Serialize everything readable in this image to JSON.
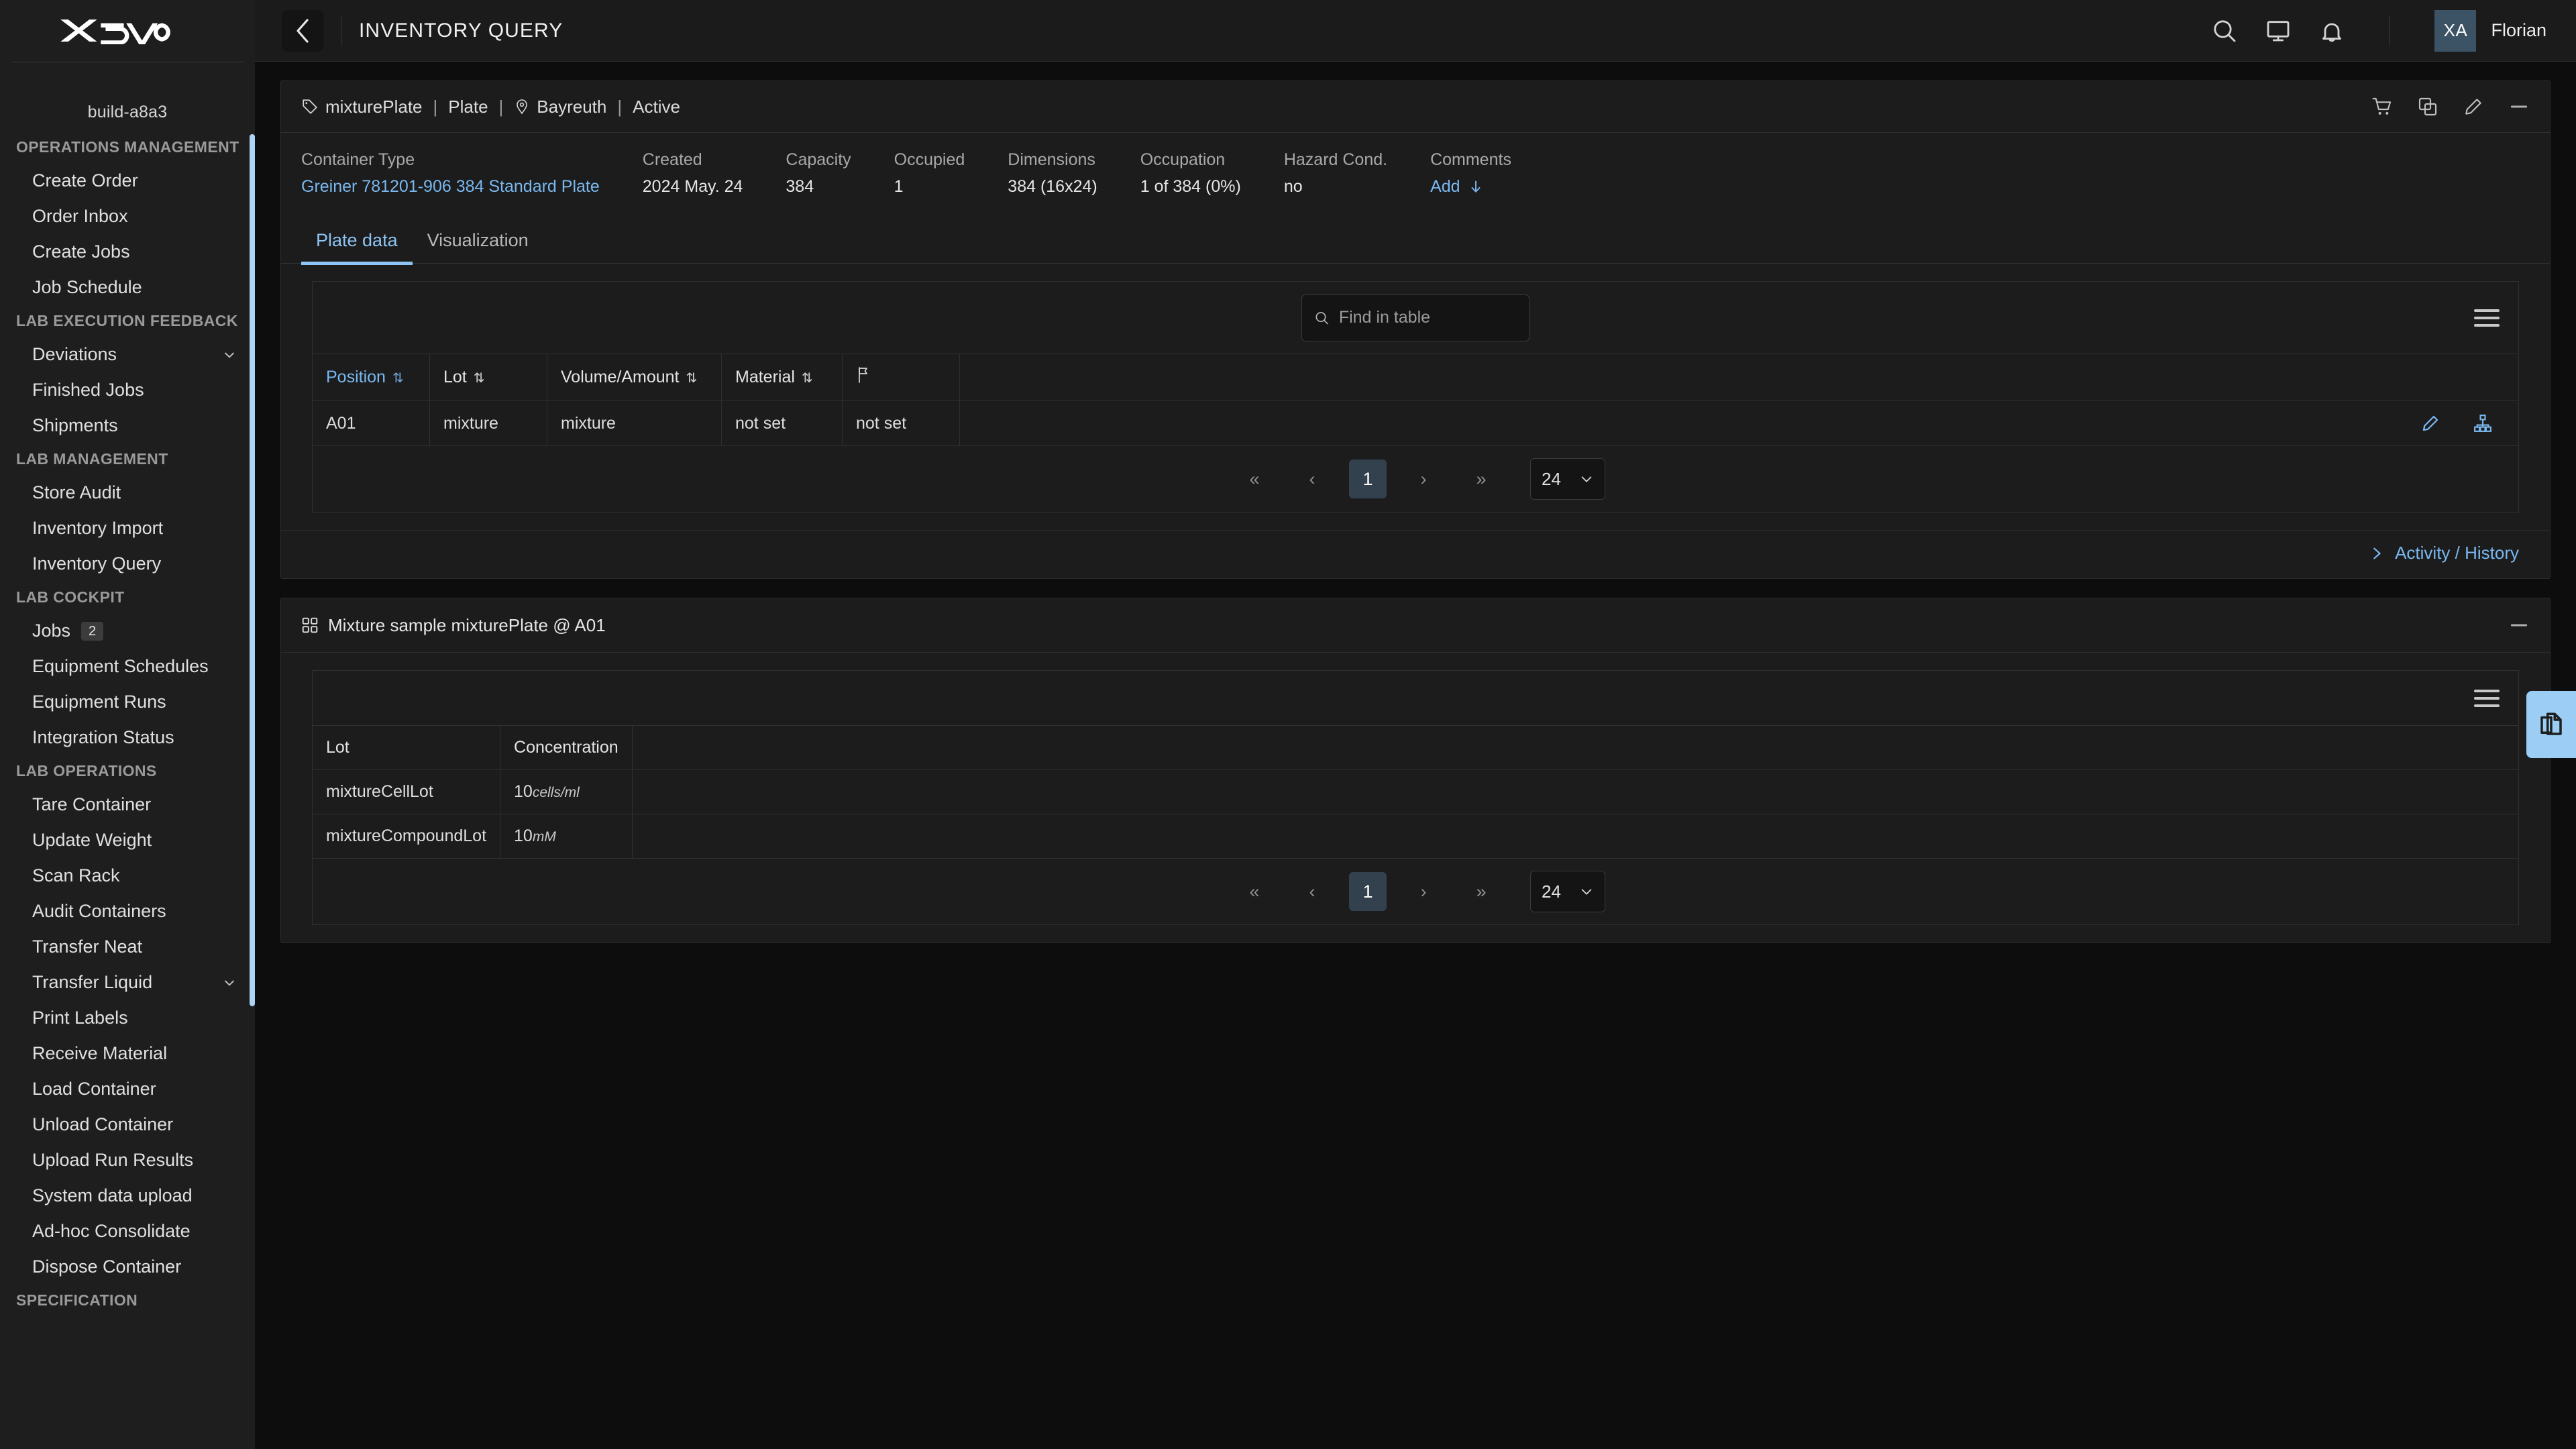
{
  "brand": {
    "logo_text": "XAVO",
    "build": "build-a8a3"
  },
  "sidebar": {
    "groups": [
      {
        "title": "OPERATIONS MANAGEMENT",
        "items": [
          {
            "label": "Create Order",
            "icon": null,
            "badge": null,
            "expandable": false
          },
          {
            "label": "Order Inbox",
            "icon": null,
            "badge": null,
            "expandable": false
          },
          {
            "label": "Create Jobs",
            "icon": null,
            "badge": null,
            "expandable": false
          },
          {
            "label": "Job Schedule",
            "icon": null,
            "badge": null,
            "expandable": false
          }
        ]
      },
      {
        "title": "LAB EXECUTION FEEDBACK",
        "items": [
          {
            "label": "Deviations",
            "badge": null,
            "expandable": true
          },
          {
            "label": "Finished Jobs",
            "badge": null,
            "expandable": false
          },
          {
            "label": "Shipments",
            "badge": null,
            "expandable": false
          }
        ]
      },
      {
        "title": "LAB MANAGEMENT",
        "items": [
          {
            "label": "Store Audit",
            "badge": null,
            "expandable": false
          },
          {
            "label": "Inventory Import",
            "badge": null,
            "expandable": false
          },
          {
            "label": "Inventory Query",
            "badge": null,
            "expandable": false
          }
        ]
      },
      {
        "title": "LAB COCKPIT",
        "items": [
          {
            "label": "Jobs",
            "badge": "2",
            "expandable": false
          },
          {
            "label": "Equipment Schedules",
            "badge": null,
            "expandable": false
          },
          {
            "label": "Equipment Runs",
            "badge": null,
            "expandable": false
          },
          {
            "label": "Integration Status",
            "badge": null,
            "expandable": false
          }
        ]
      },
      {
        "title": "LAB OPERATIONS",
        "items": [
          {
            "label": "Tare Container",
            "badge": null,
            "expandable": false
          },
          {
            "label": "Update Weight",
            "badge": null,
            "expandable": false
          },
          {
            "label": "Scan Rack",
            "badge": null,
            "expandable": false
          },
          {
            "label": "Audit Containers",
            "badge": null,
            "expandable": false
          },
          {
            "label": "Transfer Neat",
            "badge": null,
            "expandable": false
          },
          {
            "label": "Transfer Liquid",
            "badge": null,
            "expandable": true
          },
          {
            "label": "Print Labels",
            "badge": null,
            "expandable": false
          },
          {
            "label": "Receive Material",
            "badge": null,
            "expandable": false
          },
          {
            "label": "Load Container",
            "badge": null,
            "expandable": false
          },
          {
            "label": "Unload Container",
            "badge": null,
            "expandable": false
          },
          {
            "label": "Upload Run Results",
            "badge": null,
            "expandable": false
          },
          {
            "label": "System data upload",
            "badge": null,
            "expandable": false
          },
          {
            "label": "Ad-hoc Consolidate",
            "badge": null,
            "expandable": false
          },
          {
            "label": "Dispose Container",
            "badge": null,
            "expandable": false
          }
        ]
      },
      {
        "title": "SPECIFICATION",
        "items": []
      }
    ]
  },
  "topbar": {
    "title": "INVENTORY QUERY",
    "back_icon": "chevron-left-icon",
    "icons": [
      "search-icon",
      "monitor-icon",
      "bell-icon"
    ],
    "user": {
      "initials": "XA",
      "name": "Florian"
    }
  },
  "container_card": {
    "breadcrumb": {
      "tag_icon": "tag-icon",
      "name": "mixturePlate",
      "type": "Plate",
      "location_icon": "location-pin-icon",
      "location": "Bayreuth",
      "status": "Active",
      "separator": "|"
    },
    "header_icons": [
      "cart-icon",
      "copy-icon",
      "pencil-icon",
      "minimize-icon"
    ],
    "meta": [
      {
        "label": "Container Type",
        "value": "Greiner 781201-906 384 Standard Plate",
        "link": true
      },
      {
        "label": "Created",
        "value": "2024 May. 24",
        "link": false
      },
      {
        "label": "Capacity",
        "value": "384",
        "link": false
      },
      {
        "label": "Occupied",
        "value": "1",
        "link": false
      },
      {
        "label": "Dimensions",
        "value": "384 (16x24)",
        "link": false
      },
      {
        "label": "Occupation",
        "value": "1 of 384 (0%)",
        "link": false
      },
      {
        "label": "Hazard Cond.",
        "value": "no",
        "link": false
      },
      {
        "label": "Comments",
        "value": "Add",
        "link": true,
        "suffix_icon": "arrow-down-icon"
      }
    ],
    "tabs": [
      {
        "label": "Plate data",
        "active": true
      },
      {
        "label": "Visualization",
        "active": false
      }
    ],
    "search": {
      "placeholder": "Find in table",
      "value": "",
      "icon": "search-icon"
    },
    "menu_icon": "hamburger-menu-icon",
    "table": {
      "columns": [
        {
          "label": "Position",
          "sort": "↑↓",
          "sorted": true
        },
        {
          "label": "Lot",
          "sort": "↑↓",
          "sorted": false
        },
        {
          "label": "Volume/Amount",
          "sort": "↑↓",
          "sorted": false
        },
        {
          "label": "Material",
          "sort": "↑↓",
          "sorted": false
        },
        {
          "label": "",
          "icon": "flag-icon",
          "sorted": false
        },
        {
          "label": "",
          "sorted": false
        }
      ],
      "rows": [
        {
          "position": "A01",
          "lot": "mixture",
          "volume": "mixture",
          "material": "not set",
          "flag": "not set",
          "actions": [
            "pencil-icon",
            "hierarchy-icon"
          ]
        }
      ]
    },
    "pagination": {
      "first": "«",
      "prev": "‹",
      "current": "1",
      "next": "›",
      "last": "»",
      "page_size": "24"
    },
    "footer": {
      "activity_label": "Activity / History",
      "icon": "chevron-right-icon"
    }
  },
  "mixture_card": {
    "icon": "grid-icon",
    "title": "Mixture sample mixturePlate @ A01",
    "header_icons": [
      "minimize-icon"
    ],
    "menu_icon": "hamburger-menu-icon",
    "table": {
      "columns": [
        "Lot",
        "Concentration",
        ""
      ],
      "rows": [
        {
          "lot": "mixtureCellLot",
          "conc_value": "10",
          "conc_unit": "cells/ml"
        },
        {
          "lot": "mixtureCompoundLot",
          "conc_value": "10",
          "conc_unit": "mM"
        }
      ]
    },
    "pagination": {
      "first": "«",
      "prev": "‹",
      "current": "1",
      "next": "›",
      "last": "»",
      "page_size": "24"
    }
  },
  "fab": {
    "icon": "documents-icon"
  },
  "colors": {
    "accent_blue": "#79b8f0",
    "fab_blue": "#9bcdf5",
    "scrollbar": "#aed4f5",
    "avatar_bg": "#3c5366",
    "page_bg": "#0d0d0d",
    "card_bg": "#1c1c1c",
    "sidebar_bg": "#1e1e1e"
  }
}
